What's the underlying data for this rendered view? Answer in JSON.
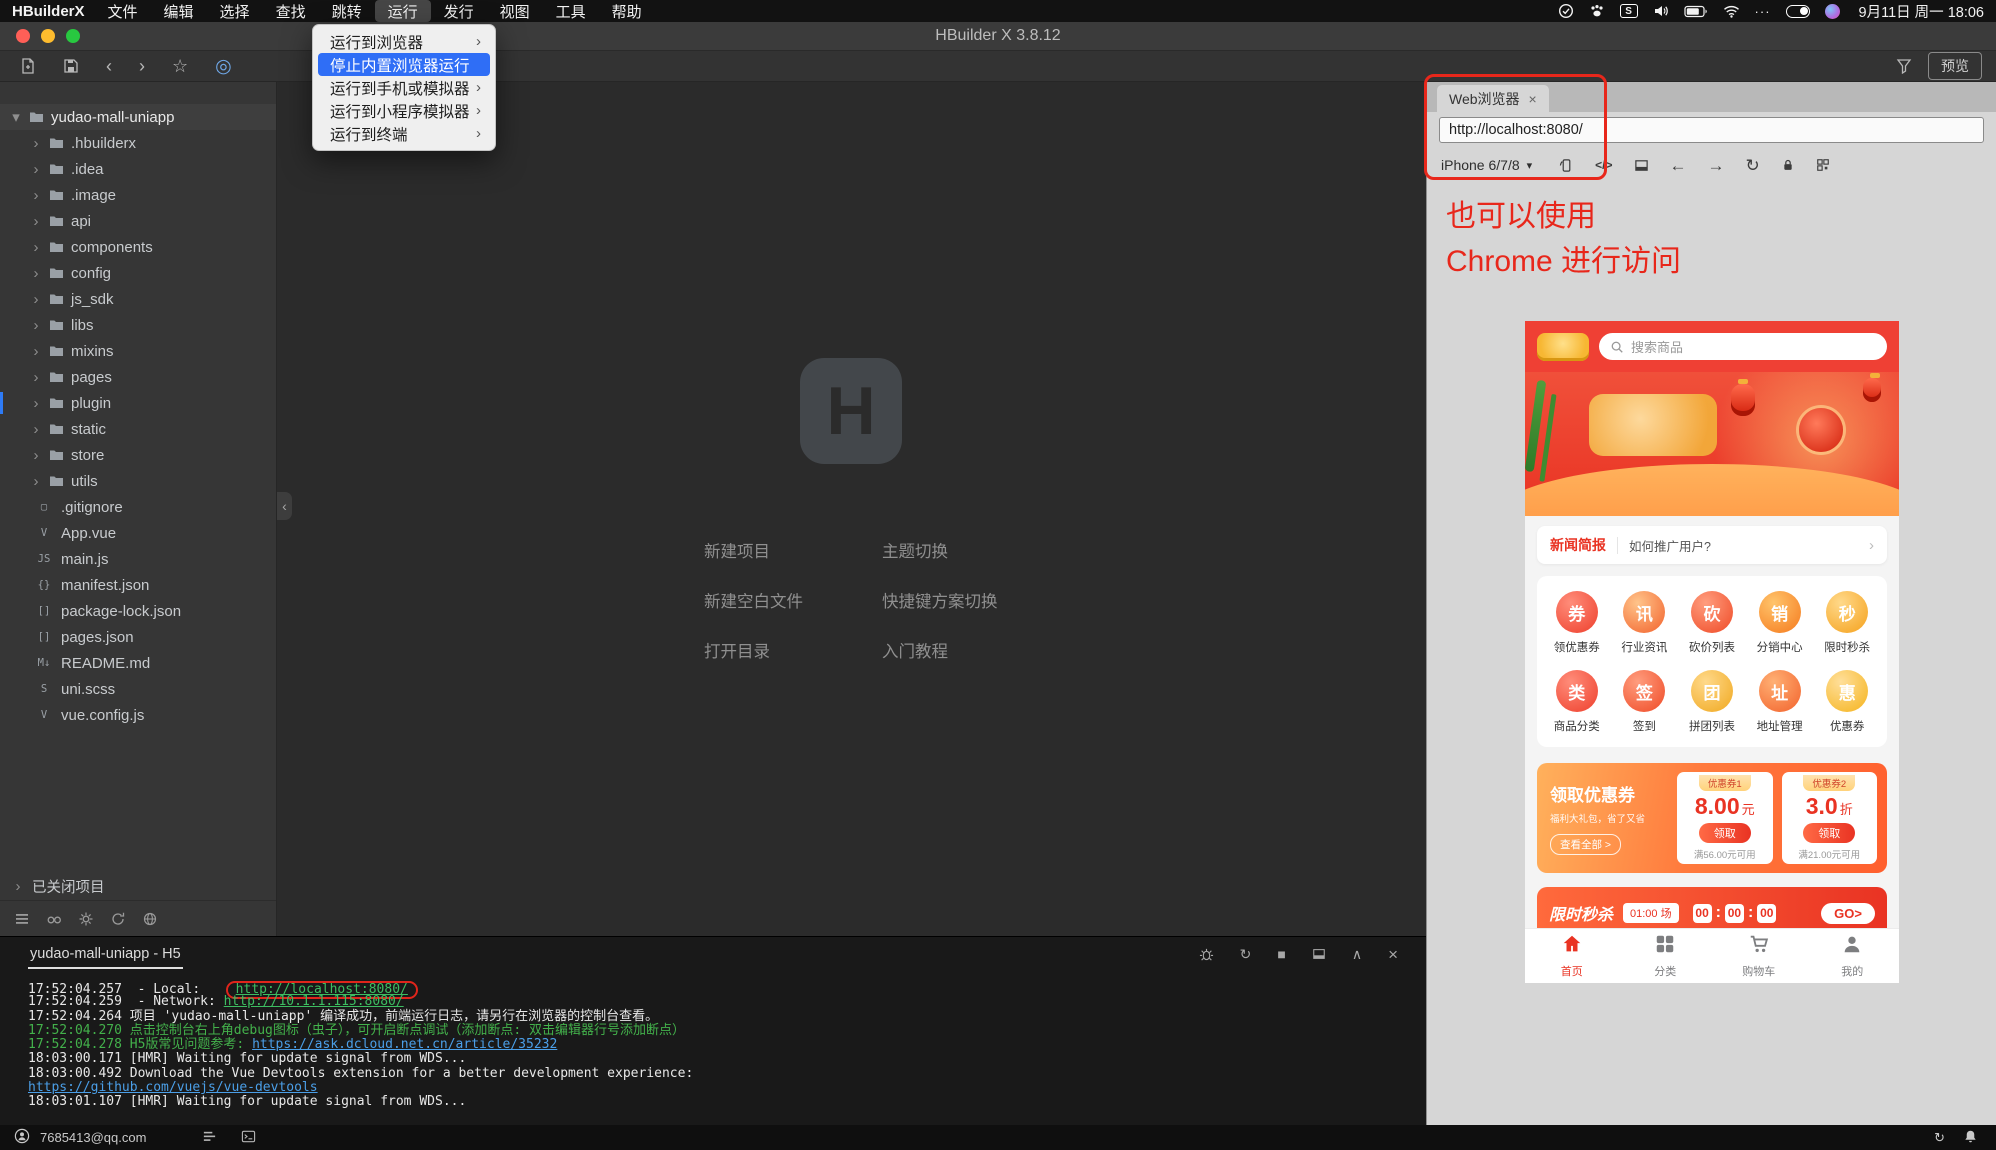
{
  "menubar": {
    "app_name": "HBuilderX",
    "items": [
      "文件",
      "编辑",
      "选择",
      "查找",
      "跳转",
      "运行",
      "发行",
      "视图",
      "工具",
      "帮助"
    ],
    "active_item": "运行",
    "datetime": "9月11日 周一 18:06"
  },
  "window": {
    "title": "HBuilder X 3.8.12"
  },
  "run_menu": {
    "items": [
      {
        "label": "运行到浏览器",
        "submenu": true,
        "active": false
      },
      {
        "label": "停止内置浏览器运行",
        "submenu": false,
        "active": true
      },
      {
        "label": "运行到手机或模拟器",
        "submenu": true,
        "active": false
      },
      {
        "label": "运行到小程序模拟器",
        "submenu": true,
        "active": false
      },
      {
        "label": "运行到终端",
        "submenu": true,
        "active": false
      }
    ]
  },
  "toolbar": {
    "preview_label": "预览"
  },
  "sidebar": {
    "project": {
      "name": "yudao-mall-uniapp"
    },
    "folders": [
      ".hbuilderx",
      ".idea",
      ".image",
      "api",
      "components",
      "config",
      "js_sdk",
      "libs",
      "mixins",
      "pages",
      "plugin",
      "static",
      "store",
      "utils"
    ],
    "current_folder": "plugin",
    "files": [
      {
        "name": ".gitignore",
        "badge": "▢"
      },
      {
        "name": "App.vue",
        "badge": "V"
      },
      {
        "name": "main.js",
        "badge": "JS"
      },
      {
        "name": "manifest.json",
        "badge": "{}"
      },
      {
        "name": "package-lock.json",
        "badge": "[]"
      },
      {
        "name": "pages.json",
        "badge": "[]"
      },
      {
        "name": "README.md",
        "badge": "M↓"
      },
      {
        "name": "uni.scss",
        "badge": "S"
      },
      {
        "name": "vue.config.js",
        "badge": "V"
      }
    ],
    "closed_projects_label": "已关闭项目"
  },
  "welcome": {
    "left_links": [
      "新建项目",
      "新建空白文件",
      "打开目录"
    ],
    "right_links": [
      "主题切换",
      "快捷键方案切换",
      "入门教程"
    ]
  },
  "console": {
    "tab_label": "yudao-mall-uniapp - H5",
    "lines": [
      {
        "segments": [
          {
            "text": "17:52:04.257  - Local:   ",
            "style": "plain"
          },
          {
            "text": "http://localhost:8080/",
            "style": "link-green",
            "boxed": true
          }
        ]
      },
      {
        "segments": [
          {
            "text": "17:52:04.259  - Network: ",
            "style": "plain"
          },
          {
            "text": "http://10.1.1.115:8080/",
            "style": "link-green"
          }
        ]
      },
      {
        "segments": [
          {
            "text": "17:52:04.264 项目 'yudao-mall-uniapp' 编译成功，前端运行日志，请另行在浏览器的控制台查看。",
            "style": "plain"
          }
        ]
      },
      {
        "segments": [
          {
            "text": "17:52:04.270 ",
            "style": "green"
          },
          {
            "text": "点击控制台右上角debug图标（虫子），可开启断点调试（添加断点: 双击编辑器行号添加断点）",
            "style": "green"
          }
        ]
      },
      {
        "segments": [
          {
            "text": "17:52:04.278 ",
            "style": "green"
          },
          {
            "text": "H5版常见问题参考: ",
            "style": "green"
          },
          {
            "text": "https://ask.dcloud.net.cn/article/35232",
            "style": "link-blue"
          }
        ]
      },
      {
        "segments": [
          {
            "text": "18:03:00.171 [HMR] Waiting for update signal from WDS...",
            "style": "plain"
          }
        ]
      },
      {
        "segments": [
          {
            "text": "18:03:00.492 Download the Vue Devtools extension for a better development experience:",
            "style": "plain"
          }
        ]
      },
      {
        "segments": [
          {
            "text": "https://github.com/vuejs/vue-devtools",
            "style": "link-blue"
          }
        ]
      },
      {
        "segments": [
          {
            "text": "18:03:01.107 [HMR] Waiting for update signal from WDS...",
            "style": "plain"
          }
        ]
      }
    ]
  },
  "statusbar": {
    "account": "7685413@qq.com"
  },
  "browser": {
    "tab_label": "Web浏览器",
    "url": "http://localhost:8080/",
    "device": "iPhone 6/7/8",
    "annotation_line1": "也可以使用",
    "annotation_line2": "Chrome 进行访问",
    "accent_color": "#e8271b"
  },
  "app_preview": {
    "search_placeholder": "搜索商品",
    "news_badge": "新闻简报",
    "news_text": "如何推广用户?",
    "active_color": "#e93323",
    "inactive_color": "#7d7e80",
    "nav_items": [
      {
        "label": "领优惠券",
        "glyph": "券",
        "c1": "#ff8d7a",
        "c2": "#ee3f2c"
      },
      {
        "label": "行业资讯",
        "glyph": "讯",
        "c1": "#ffc48a",
        "c2": "#f2622c"
      },
      {
        "label": "砍价列表",
        "glyph": "砍",
        "c1": "#ff9d7e",
        "c2": "#ef4a26"
      },
      {
        "label": "分销中心",
        "glyph": "销",
        "c1": "#ffc46b",
        "c2": "#f57a1e"
      },
      {
        "label": "限时秒杀",
        "glyph": "秒",
        "c1": "#ffd98a",
        "c2": "#f5a11c"
      },
      {
        "label": "商品分类",
        "glyph": "类",
        "c1": "#ff8d7a",
        "c2": "#ee3f2c"
      },
      {
        "label": "签到",
        "glyph": "签",
        "c1": "#ff9d7e",
        "c2": "#ef4a26"
      },
      {
        "label": "拼团列表",
        "glyph": "团",
        "c1": "#ffd98a",
        "c2": "#f0a81f"
      },
      {
        "label": "地址管理",
        "glyph": "址",
        "c1": "#ffb074",
        "c2": "#f2622c"
      },
      {
        "label": "优惠券",
        "glyph": "惠",
        "c1": "#ffdf9a",
        "c2": "#f5b31c"
      }
    ],
    "coupon": {
      "title": "领取优惠券",
      "subtitle": "福利大礼包，省了又省",
      "more": "查看全部 >",
      "items": [
        {
          "tag": "优惠券1",
          "value": "8.00",
          "unit": "元",
          "button": "领取",
          "condition": "满56.00元可用"
        },
        {
          "tag": "优惠券2",
          "value": "3.0",
          "unit": "折",
          "button": "领取",
          "condition": "满21.00元可用"
        }
      ]
    },
    "seckill": {
      "title": "限时秒杀",
      "session": "01:00 场",
      "timer": [
        "00",
        "00",
        "00"
      ],
      "go": "GO>"
    },
    "tabbar": [
      {
        "label": "首页",
        "icon": "home",
        "active": true
      },
      {
        "label": "分类",
        "icon": "grid",
        "active": false
      },
      {
        "label": "购物车",
        "icon": "cart",
        "active": false
      },
      {
        "label": "我的",
        "icon": "user",
        "active": false
      }
    ]
  }
}
